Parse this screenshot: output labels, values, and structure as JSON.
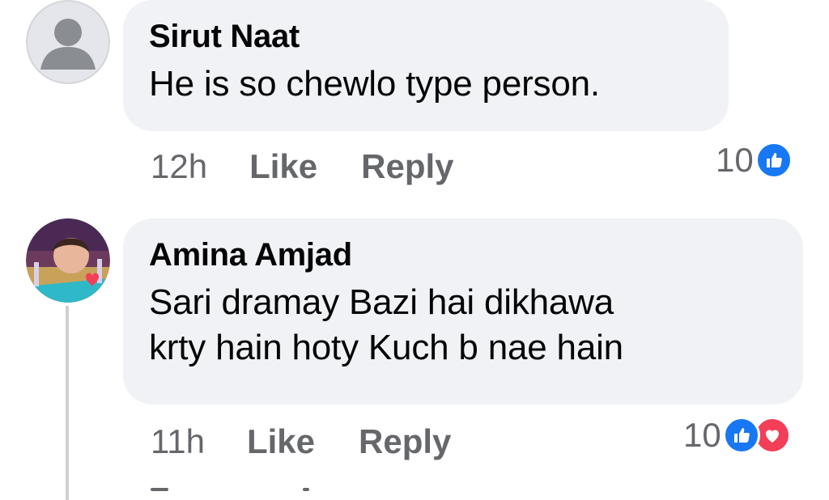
{
  "comments": [
    {
      "author": "Sirut Naat",
      "text": "He is so chewlo type person.",
      "time": "12h",
      "like_label": "Like",
      "reply_label": "Reply",
      "reaction_count": "10",
      "reactions": [
        "like-icon"
      ]
    },
    {
      "author": "Amina Amjad",
      "text_line1": "Sari dramay Bazi hai dikhawa",
      "text_line2": "krty hain hoty Kuch b nae hain",
      "time": "11h",
      "like_label": "Like",
      "reply_label": "Reply",
      "reaction_count": "10",
      "reactions": [
        "like-icon",
        "love-icon"
      ]
    }
  ],
  "colors": {
    "like_blue": "#1877f2",
    "love_red": "#f33e58",
    "bubble": "#f0f2f5",
    "meta_text": "#65676b"
  }
}
